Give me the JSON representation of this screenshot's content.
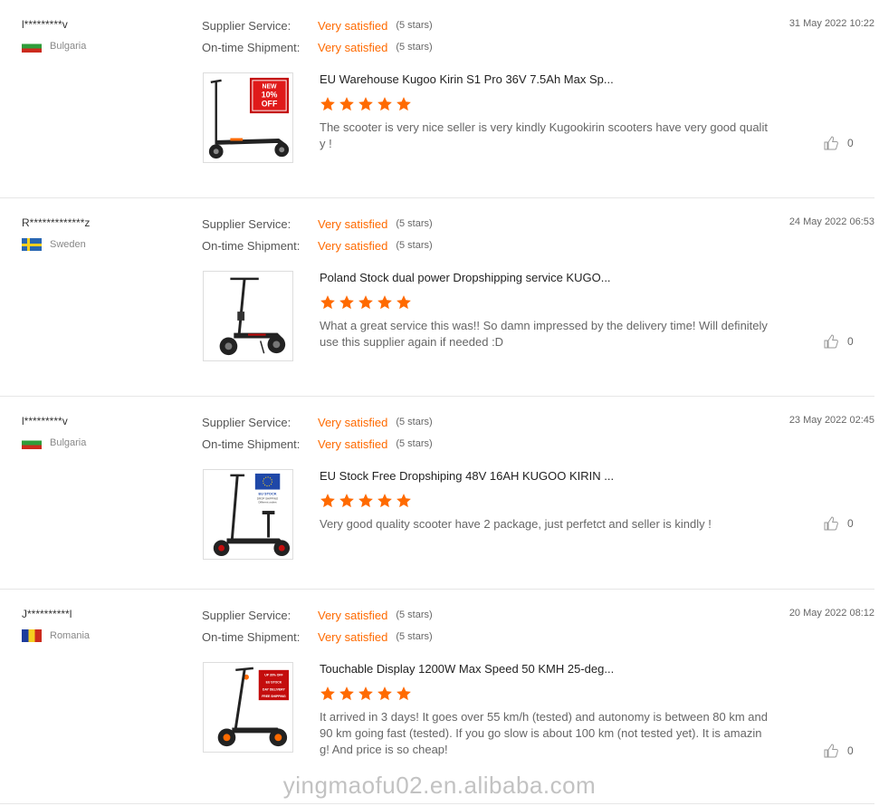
{
  "labels": {
    "supplier_service": "Supplier Service:",
    "ontime_shipment": "On-time Shipment:"
  },
  "colors": {
    "accent": "#ff6a00",
    "divider": "#e6e6e6"
  },
  "reviews": [
    {
      "reviewer": "l*********v",
      "country": "Bulgaria",
      "flag_icon": "flag-bulgaria-icon",
      "supplier_rating": "Very satisfied",
      "supplier_stars": "(5 stars)",
      "shipment_rating": "Very satisfied",
      "shipment_stars": "(5 stars)",
      "date": "31 May 2022 10:22",
      "product_title": "EU Warehouse Kugoo Kirin S1 Pro 36V 7.5Ah Max Sp...",
      "stars": 5,
      "comment": "The scooter is very nice seller is very kindly Kugookirin scooters have very good quality !",
      "helpful_count": "0",
      "badge_lines": [
        "NEW",
        "10%",
        "OFF"
      ]
    },
    {
      "reviewer": "R*************z",
      "country": "Sweden",
      "flag_icon": "flag-sweden-icon",
      "supplier_rating": "Very satisfied",
      "supplier_stars": "(5 stars)",
      "shipment_rating": "Very satisfied",
      "shipment_stars": "(5 stars)",
      "date": "24 May 2022 06:53",
      "product_title": "Poland Stock dual power Dropshipping service KUGO...",
      "stars": 5,
      "comment": "What a great service this was!! So damn impressed by the delivery time! Will definitely use this supplier again if needed :D",
      "helpful_count": "0"
    },
    {
      "reviewer": "l*********v",
      "country": "Bulgaria",
      "flag_icon": "flag-bulgaria-icon",
      "supplier_rating": "Very satisfied",
      "supplier_stars": "(5 stars)",
      "shipment_rating": "Very satisfied",
      "shipment_stars": "(5 stars)",
      "date": "23 May 2022 02:45",
      "product_title": "EU Stock Free Dropshiping 48V 16AH KUGOO KIRIN ...",
      "stars": 5,
      "comment": "Very good quality scooter have 2 package, just perfetct and seller is kindly !",
      "helpful_count": "0",
      "badge_lines": [
        "EU STOCK",
        "DROP SHIPPING",
        "Different orders"
      ]
    },
    {
      "reviewer": "J**********l",
      "country": "Romania",
      "flag_icon": "flag-romania-icon",
      "supplier_rating": "Very satisfied",
      "supplier_stars": "(5 stars)",
      "shipment_rating": "Very satisfied",
      "shipment_stars": "(5 stars)",
      "date": "20 May 2022 08:12",
      "product_title": "Touchable Display 1200W Max Speed 50 KMH 25-deg...",
      "stars": 5,
      "comment": "It arrived in 3 days! It goes over 55 km/h (tested) and autonomy is between 80 km and 90 km going fast (tested). If you go slow is about 100 km (not tested yet). It is amazing! And price is so cheap!",
      "helpful_count": "0",
      "badge_lines": [
        "UP 30% OFF",
        "EU STOCK",
        "DAY DELIVERY",
        "FREE SHIPPING"
      ]
    }
  ],
  "watermark": "yingmaofu02.en.alibaba.com"
}
